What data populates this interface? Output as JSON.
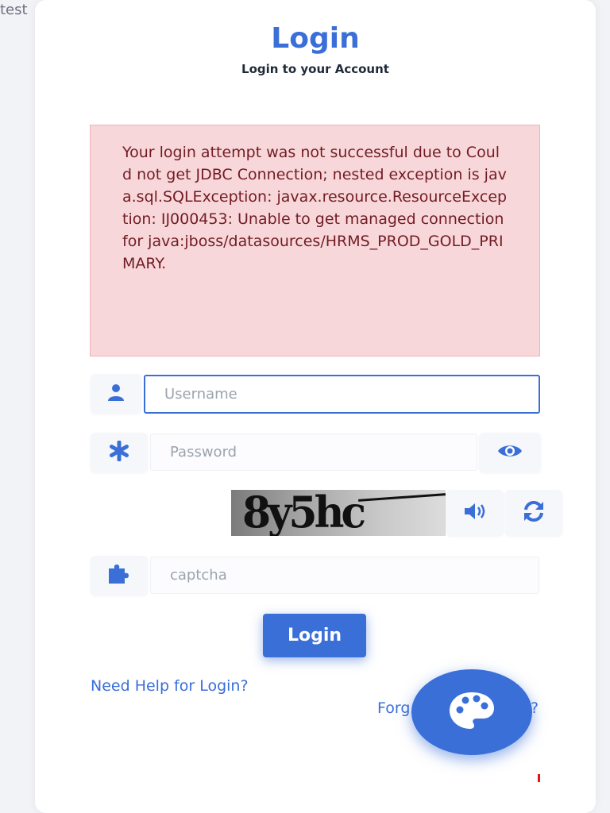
{
  "corner_text": "test",
  "header": {
    "title": "Login",
    "subtitle": "Login to your Account"
  },
  "alert": {
    "message": "Your login attempt was not successful due to Could not get JDBC Connection; nested exception is java.sql.SQLException: javax.resource.ResourceException: IJ000453: Unable to get managed connection for java:jboss/datasources/HRMS_PROD_GOLD_PRIMARY."
  },
  "form": {
    "username_placeholder": "Username",
    "password_placeholder": "Password",
    "captcha_text": "8y5hc",
    "captcha_placeholder": "captcha",
    "login_label": "Login"
  },
  "links": {
    "need_help": "Need Help for Login?",
    "forgot_password_visible": "Forg",
    "forgot_password_tail": "?"
  },
  "icons": {
    "user": "user-icon",
    "password": "asterisk-icon",
    "show_password": "eye-icon",
    "audio": "speaker-icon",
    "refresh": "refresh-icon",
    "captcha": "puzzle-icon",
    "theme": "palette-icon"
  },
  "colors": {
    "accent": "#3a6fd8",
    "alert_bg": "#f8d7da",
    "alert_text": "#721c24"
  }
}
